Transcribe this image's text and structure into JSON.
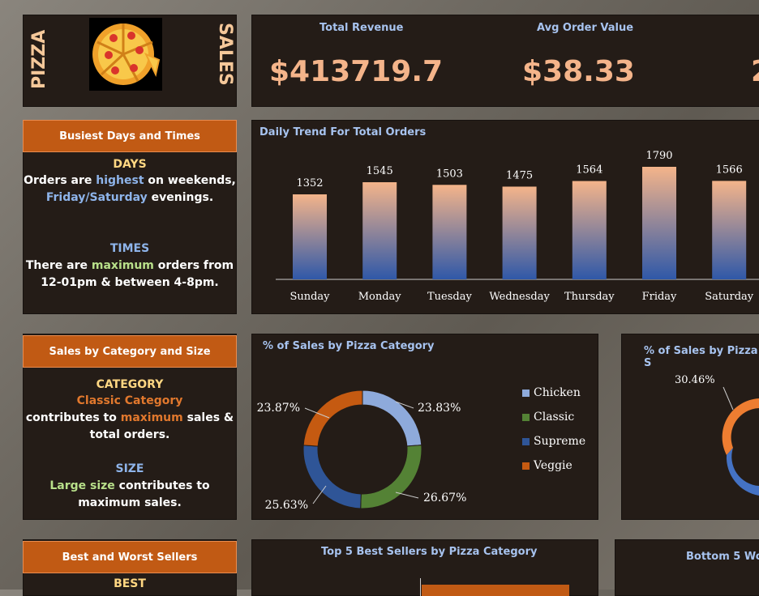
{
  "header": {
    "left_vertical": "PIZZA",
    "right_vertical": "SALES"
  },
  "kpis": {
    "total_revenue_label": "Total Revenue",
    "total_revenue_value": "$413719.7",
    "avg_order_label": "Avg Order Value",
    "avg_order_value": "$38.33",
    "third_partial_value": "2"
  },
  "busiest": {
    "header": "Busiest Days and Times",
    "days_title": "DAYS",
    "days_line1_pre": "Orders are ",
    "days_line1_hl": "highest",
    "days_line1_post": " on weekends,",
    "days_line2_hl": "Friday/Saturday",
    "days_line2_post": " evenings.",
    "times_title": "TIMES",
    "times_line1_pre": "There are ",
    "times_line1_hl": "maximum",
    "times_line1_post": " orders from",
    "times_line2": "12-01pm & between 4-8pm."
  },
  "category_size": {
    "header": "Sales by Category and Size",
    "category_title": "CATEGORY",
    "category_line1": "Classic Category",
    "category_line2_pre": "contributes to ",
    "category_line2_hl": "maximum",
    "category_line2_post": " sales &",
    "category_line3": "total orders.",
    "size_title": "SIZE",
    "size_line1_hl": "Large size",
    "size_line1_post": " contributes to",
    "size_line2": "maximum sales."
  },
  "best_worst": {
    "header": "Best and Worst Sellers",
    "best_title": "BEST"
  },
  "daily_chart_title": "Daily Trend For Total Orders",
  "category_chart_title": "% of Sales by Pizza Category",
  "size_chart_title": "% of Sales by Pizza S",
  "top5_title": "Top 5 Best Sellers by Pizza Category",
  "bottom5_title": "Bottom 5 Wor",
  "legend": [
    {
      "label": "Chicken",
      "color": "#8eaadb"
    },
    {
      "label": "Classic",
      "color": "#548235"
    },
    {
      "label": "Supreme",
      "color": "#2f5597"
    },
    {
      "label": "Veggie",
      "color": "#c55a11"
    }
  ],
  "chart_data": [
    {
      "type": "bar",
      "title": "Daily Trend For Total Orders",
      "categories": [
        "Sunday",
        "Monday",
        "Tuesday",
        "Wednesday",
        "Thursday",
        "Friday",
        "Saturday"
      ],
      "values": [
        1352,
        1545,
        1503,
        1475,
        1564,
        1790,
        1566
      ],
      "ylim": [
        0,
        1790
      ]
    },
    {
      "type": "pie",
      "title": "% of Sales by Pizza Category",
      "categories": [
        "Chicken",
        "Classic",
        "Supreme",
        "Veggie"
      ],
      "values": [
        23.83,
        26.67,
        25.63,
        23.87
      ],
      "labels": [
        "23.83%",
        "26.67%",
        "25.63%",
        "23.87%"
      ]
    },
    {
      "type": "pie",
      "title": "% of Sales by Pizza S",
      "labels_visible": [
        "30.46%"
      ]
    }
  ]
}
